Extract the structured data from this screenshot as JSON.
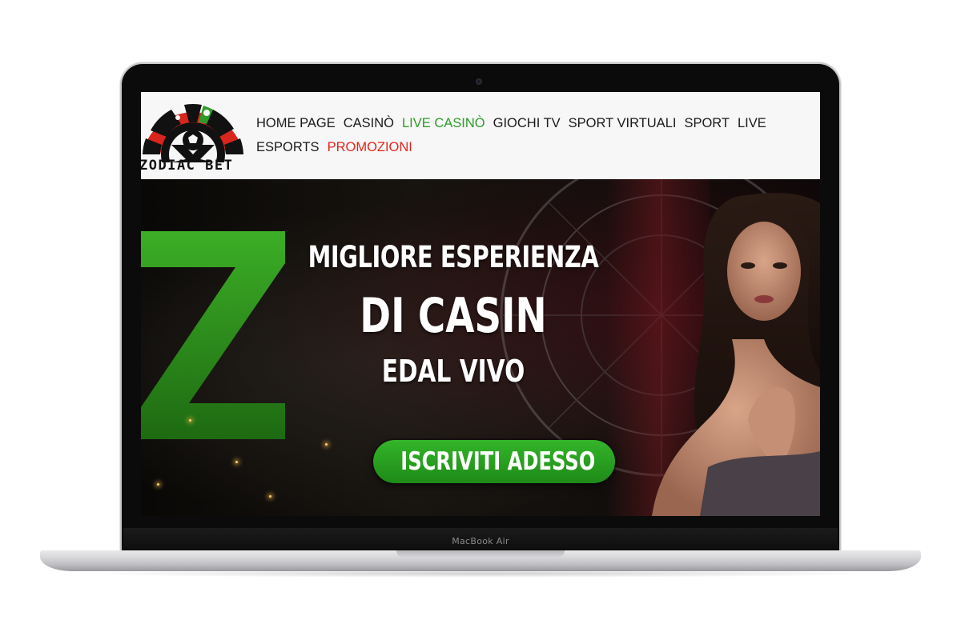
{
  "device": {
    "model_label": "MacBook Air"
  },
  "header": {
    "logo_text": "ZODIAC BET",
    "nav_row1": [
      "HOME PAGE",
      "CASINÒ",
      "LIVE CASINÒ",
      "GIOCHI TV",
      "SPORT VIRTUALI",
      "SPORT",
      "LIVE"
    ],
    "nav_row2": [
      "ESPORTS",
      "PROMOZIONI"
    ],
    "active_item": "LIVE CASINÒ",
    "highlight_item": "PROMOZIONI"
  },
  "hero": {
    "line1": "MIGLIORE ESPERIENZA",
    "line2": "DI CASIN",
    "line3": "EDAL VIVO",
    "cta_label": "ISCRIVITI ADESSO",
    "background_letter": "Z"
  },
  "colors": {
    "accent_green": "#2e9b28",
    "promo_red": "#e3261d",
    "cta_green": "#2aa322",
    "header_bg": "#f7f7f7"
  }
}
